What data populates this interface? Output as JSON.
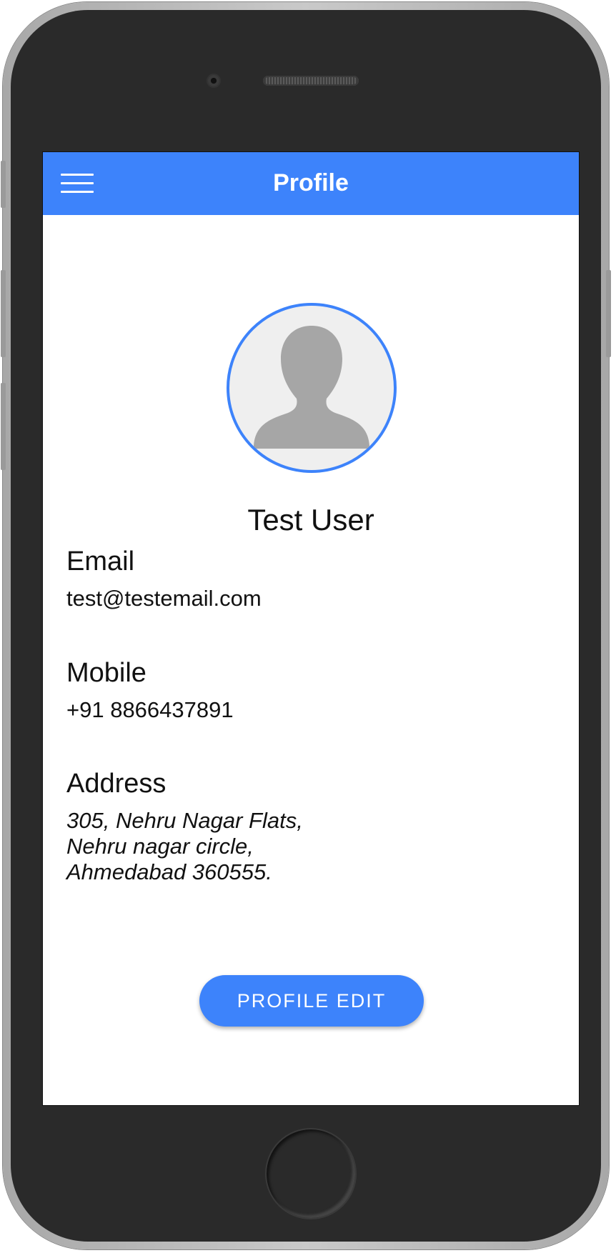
{
  "header": {
    "title": "Profile",
    "menu_icon": "hamburger-menu-icon"
  },
  "profile": {
    "avatar_icon": "user-silhouette-icon",
    "name": "Test User"
  },
  "fields": {
    "email": {
      "label": "Email",
      "value": "test@testemail.com"
    },
    "mobile": {
      "label": "Mobile",
      "value": "+91 8866437891"
    },
    "address": {
      "label": "Address",
      "lines": [
        "305, Nehru Nagar Flats,",
        "Nehru nagar circle,",
        "Ahmedabad 360555."
      ]
    }
  },
  "actions": {
    "edit_label": "PROFILE EDIT"
  },
  "colors": {
    "accent": "#3d83fb",
    "avatar_bg": "#efefef",
    "silhouette": "#a6a6a6",
    "device_body": "#2a2a2a"
  }
}
